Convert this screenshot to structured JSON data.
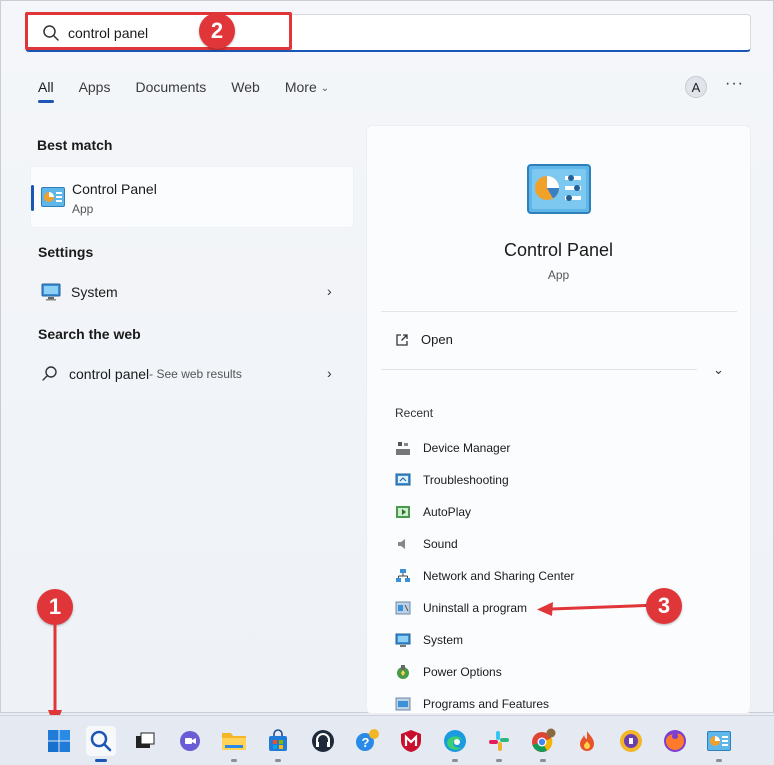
{
  "search": {
    "value": "control panel",
    "placeholder": ""
  },
  "tabs": [
    {
      "label": "All",
      "active": true
    },
    {
      "label": "Apps"
    },
    {
      "label": "Documents"
    },
    {
      "label": "Web"
    },
    {
      "label": "More"
    }
  ],
  "avatar": {
    "initial": "A"
  },
  "more_options": "···",
  "best_match": {
    "title": "Best match",
    "item": {
      "name": "Control Panel",
      "type": "App"
    }
  },
  "settings": {
    "title": "Settings",
    "item": {
      "name": "System"
    }
  },
  "web": {
    "title": "Search the web",
    "item": {
      "query": "control panel",
      "suffix": " - See web results"
    }
  },
  "detail": {
    "title": "Control Panel",
    "type": "App",
    "open_label": "Open",
    "recent_label": "Recent",
    "recent": [
      "Device Manager",
      "Troubleshooting",
      "AutoPlay",
      "Sound",
      "Network and Sharing Center",
      "Uninstall a program",
      "System",
      "Power Options",
      "Programs and Features"
    ]
  },
  "annotations": {
    "badge1": "1",
    "badge2": "2",
    "badge3": "3"
  },
  "colors": {
    "accent": "#1a56b5",
    "annotation": "#e0363a"
  }
}
